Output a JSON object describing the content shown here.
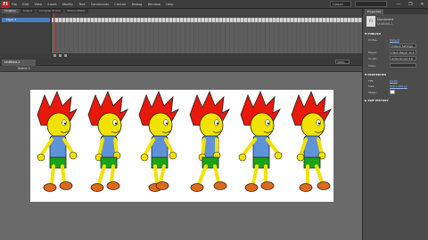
{
  "app": {
    "logo": "Fl",
    "menu": [
      "File",
      "Edit",
      "View",
      "Insert",
      "Modify",
      "Text",
      "Commands",
      "Control",
      "Debug",
      "Window",
      "Help"
    ],
    "workspace": "Classic",
    "window_controls": [
      "—",
      "❐",
      "✕"
    ]
  },
  "timeline": {
    "tabs": [
      "Timeline",
      "Output",
      "Compiler Errors",
      "Motion Editor"
    ],
    "layer_name": "Layer 1",
    "current_frame": 1,
    "total_frames": 6
  },
  "document": {
    "tab": "Untitled-1",
    "scene": "Scene 1",
    "zoom": "100%"
  },
  "properties": {
    "tab": "Properties",
    "doc_label": "Document",
    "doc_name": "Untitled-1",
    "publish_title": "▼ PUBLISH",
    "profile_label": "Profile:",
    "profile_value": "Default",
    "settings_btn": "Publish Settings...",
    "player_label": "Player:",
    "player_value": "Flash Player 11.2",
    "script_label": "Script:",
    "script_value": "ActionScript 3.0",
    "class_label": "Class:",
    "props_title": "▼ PROPERTIES",
    "fps_label": "FPS:",
    "fps_value": "24.00",
    "size_label": "Size:",
    "size_value": "550 x 400 px",
    "stage_label": "Stage:",
    "history_title": "▶ SWF HISTORY"
  },
  "colors": {
    "hair": "#e8180a",
    "skin": "#f2e200",
    "shirt": "#5f93d8",
    "pants": "#19a319",
    "shoes": "#e06818"
  },
  "frames": [
    1,
    2,
    3,
    4,
    5,
    6
  ]
}
